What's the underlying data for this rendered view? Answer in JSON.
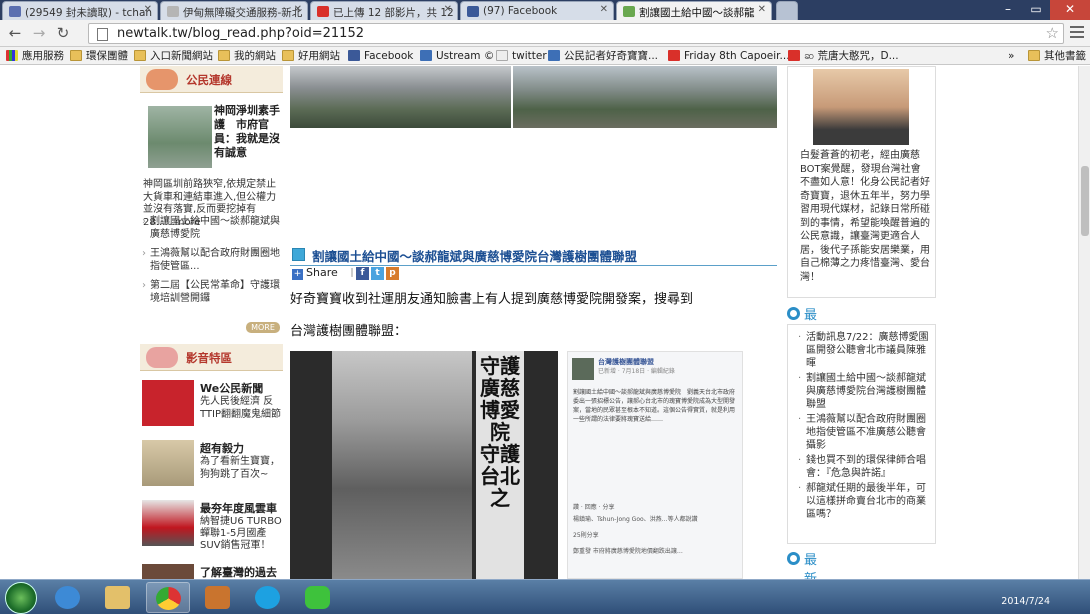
{
  "tabs": [
    {
      "label": "(29549 封未讀取) - tchan",
      "color": "#5b6fb0"
    },
    {
      "label": "伊甸無障礙交通服務-新北",
      "color": "#888888"
    },
    {
      "label": "已上傳 12 部影片，共 12",
      "color": "#d9302a"
    },
    {
      "label": "(97) Facebook",
      "color": "#3b5998"
    },
    {
      "label": "割讓國土給中國～談郝龍",
      "color": "#6aa84f"
    }
  ],
  "toolbar": {
    "back_icon": "←",
    "forward_icon": "→",
    "reload_icon": "↻",
    "url": "newtalk.tw/blog_read.php?oid=21152",
    "star_icon": "☆"
  },
  "bookmarks": [
    {
      "label": "應用服務",
      "type": "apps"
    },
    {
      "label": "環保團體",
      "type": "folder"
    },
    {
      "label": "入口新聞網站",
      "type": "folder"
    },
    {
      "label": "我的網站",
      "type": "folder"
    },
    {
      "label": "好用網站",
      "type": "folder"
    },
    {
      "label": "Facebook",
      "type": "fb"
    },
    {
      "label": "Ustream ©",
      "type": "u"
    },
    {
      "label": "twitter",
      "type": "page"
    },
    {
      "label": "公民記者好奇寶寶...",
      "type": "u"
    },
    {
      "label": "Friday 8th Capoeir...",
      "type": "yt"
    },
    {
      "label": "ဆ 荒唐大憨咒，D...",
      "type": "yt"
    },
    {
      "label": "»",
      "type": "none"
    },
    {
      "label": "其他書籤",
      "type": "folder"
    }
  ],
  "left": {
    "section1": "公民連線",
    "news1_title": "神岡淨圳素手護　市府官員：我就是沒有誠意",
    "news1_desc": "神岡區圳前路狹窄,依規定禁止大貨車和連結車進入,但公權力並沒有落實,反而要挖掉有28......more",
    "list": [
      "割讓國土給中國～談郝龍斌與廣慈博愛院",
      "王鴻薇幫以配合政府財團圈地指使管區...",
      "第二屆【公民常革命】守護環境培訓營開鑼"
    ],
    "more": "MORE",
    "section2": "影音特區",
    "videos": [
      {
        "title": "We公民新聞",
        "desc": "先人民後經濟 反TTIP翻翻魔鬼細節"
      },
      {
        "title": "超有毅力",
        "desc": "為了看新生寶寶，狗狗跳了百次~"
      },
      {
        "title": "最夯年度風雲車",
        "desc": "納智捷U6 TURBO蟬聯1-5月國產SUV銷售冠軍！"
      },
      {
        "title": "了解臺灣的過去",
        "desc": ""
      }
    ]
  },
  "article": {
    "title": "割讓國土給中國～談郝龍斌與廣慈博愛院台灣護樹團體聯盟",
    "share": "Share",
    "para1": "好奇寶寶收到社運朋友通知臉書上有人提到廣慈博愛院開發案，搜尋到",
    "para2": "台灣護樹團體聯盟：",
    "sign_text": "守護廣慈博愛院　守護台北之",
    "fb_name": "台灣護樹團體聯盟",
    "fb_sub": "已新增 · 7月18日 · 編輯紀錄",
    "fb_body": "割讓國土給中國～談郝龍斌與廣慈博愛院　劉義天台北市政府委出一張招標公告，讓郝心台北市的瑰寶博愛院成為大型開發案，當地的民眾甚至根本不知道。這個公告得實質，就是利用一些所謂的法律要將瑰寶送給……",
    "fb_actions": "讚 · 回應 · 分享",
    "fb_like": "楊鎮瑜、Tshun-Jong Goo、洪燕…等人都說讚",
    "fb_shares": "25則分享",
    "fb_comment": "鄭重發 市府將廣慈博愛院地價翻跌出讓…"
  },
  "right": {
    "profile_text": "白髮蒼蒼的初老，經由廣慈BOT案覺醒，發現台灣社會不盡如人意！化身公民記者好奇寶寶，退休五年半，努力學習用現代媒材，記錄日常所碰到的事情，希望能喚醒普遍的公民意識，讓臺灣更適合人居，後代子孫能安居樂業，用自己棉薄之力疼惜臺灣、愛台灣！",
    "latest_articles": "最新文章",
    "articles": [
      "活動訊息7/22：廣慈博愛園區開發公聽會北市議員陳雅暉",
      "割讓國土給中國～談郝龍斌與廣慈博愛院台灣護樹團體聯盟",
      "王鴻薇幫以配合政府財團圈地指使管區不准廣慈公聽會攝影",
      "錢也買不到的環保律師合唱會：『危急與許諾』",
      "郝龍斌任期的最後半年，可以這樣拼命賣台北市的商業區嗎？"
    ],
    "latest_replies": "最新回應"
  },
  "taskbar": {
    "date": "2014/7/24",
    "apps": [
      "ie",
      "explorer",
      "chrome",
      "winamp",
      "skype",
      "line"
    ]
  }
}
